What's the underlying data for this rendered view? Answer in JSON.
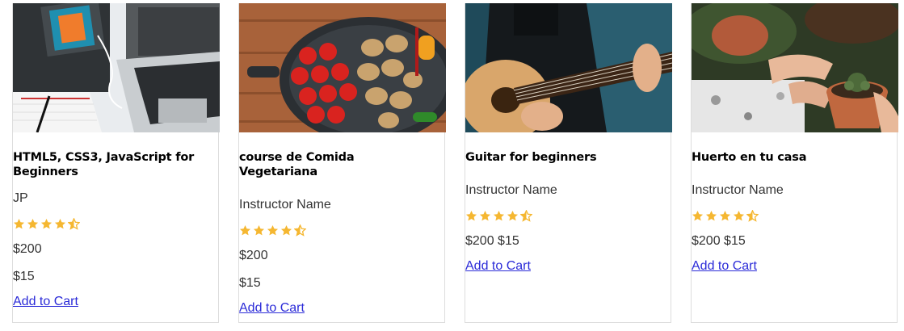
{
  "courses": [
    {
      "title": "HTML5, CSS3, JavaScript for Beginners",
      "instructor": "JP",
      "rating": 4.5,
      "price": "$200",
      "discount_price": "$15",
      "cart_label": "Add to Cart",
      "image_icon": "laptop-book-image"
    },
    {
      "title": "course de Comida Vegetariana",
      "instructor": "Instructor Name",
      "rating": 4.5,
      "price": "$200",
      "discount_price": "$15",
      "cart_label": "Add to Cart",
      "image_icon": "vegetables-pot-image"
    },
    {
      "title": "Guitar for beginners",
      "instructor": "Instructor Name",
      "rating": 4.5,
      "price_line": "$200 $15",
      "cart_label": "Add to Cart",
      "image_icon": "guitar-image"
    },
    {
      "title": "Huerto en tu casa",
      "instructor": "Instructor Name",
      "rating": 4.5,
      "price_line": "$200 $15",
      "cart_label": "Add to Cart",
      "image_icon": "plant-pot-image"
    }
  ],
  "colors": {
    "star": "#f5b731",
    "link": "#2b2bd8",
    "border": "#dddddd"
  }
}
